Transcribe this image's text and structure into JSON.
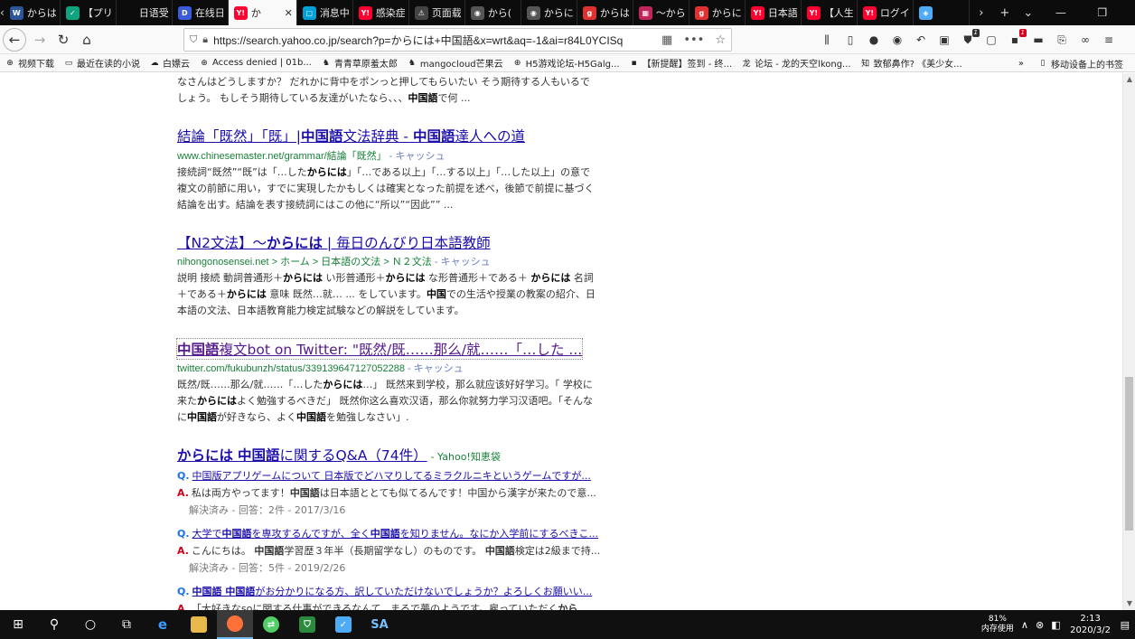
{
  "tabs": [
    {
      "label": "からは",
      "icon": "W",
      "color": "#2b579a"
    },
    {
      "label": "【プリ",
      "icon": "✓",
      "color": "#10a37f"
    },
    {
      "label": "日语受付",
      "icon": "",
      "color": "#0c0c0d"
    },
    {
      "label": "在线日",
      "icon": "D",
      "color": "#3b5bdb"
    },
    {
      "label": "か",
      "icon": "Y!",
      "color": "#ff0033",
      "active": true
    },
    {
      "label": "消息中",
      "icon": "▢",
      "color": "#00a1d6"
    },
    {
      "label": "感染症",
      "icon": "Y!",
      "color": "#ff0033"
    },
    {
      "label": "页面载",
      "icon": "⚠",
      "color": "#444444"
    },
    {
      "label": "から(",
      "icon": "◉",
      "color": "#555555"
    },
    {
      "label": "からに",
      "icon": "◉",
      "color": "#555555"
    },
    {
      "label": "からは",
      "icon": "g",
      "color": "#e03131"
    },
    {
      "label": "～から",
      "icon": "▦",
      "color": "#c2255c"
    },
    {
      "label": "からに",
      "icon": "g",
      "color": "#e03131"
    },
    {
      "label": "日本語",
      "icon": "Y!",
      "color": "#ff0033"
    },
    {
      "label": "【人生",
      "icon": "Y!",
      "color": "#ff0033"
    },
    {
      "label": "ログイ",
      "icon": "Y!",
      "color": "#ff0033"
    },
    {
      "label": "",
      "icon": "◈",
      "color": "#4dabf7"
    }
  ],
  "nav": {
    "url": "https://search.yahoo.co.jp/search?p=からには+中国語&x=wrt&aq=-1&ai=r84L0YCISq"
  },
  "bookmarks": [
    {
      "label": "视频下载",
      "icon": "⊕"
    },
    {
      "label": "最近在读的小说",
      "icon": "▭"
    },
    {
      "label": "白嫖云",
      "icon": "☁"
    },
    {
      "label": "Access denied | 01b...",
      "icon": "⊕"
    },
    {
      "label": "青青草原羞太郎",
      "icon": "♞"
    },
    {
      "label": "mangocloud芒果云",
      "icon": "♞"
    },
    {
      "label": "H5游戏论坛-H5Galg...",
      "icon": "⊕"
    },
    {
      "label": "【新提醒】签到 - 终...",
      "icon": "▪"
    },
    {
      "label": "论坛 - 龙的天空lkong...",
      "icon": "龙"
    },
    {
      "label": "致郁鼻作? 《美少女...",
      "icon": "知"
    }
  ],
  "bookmarks_mobile": "移动设备上的书签",
  "results": {
    "top_snippet": "なさんはどうしますか？ だれかに背中をポンっと押してもらいたい そう期待する人もいるでしょう。 もしそう期待している友達がいたなら、、、",
    "top_snippet_bold": "中国語",
    "top_snippet_tail": "で何 ...",
    "r1": {
      "title_a": "結論「既然」「既」|",
      "title_b": "中国語",
      "title_c": "文法辞典 -",
      "title_d": "中国語",
      "title_e": "達人への道",
      "url": "www.chinesemaster.net/grammar/結論「既然」",
      "cache": "- キャッシュ",
      "snippet": "接続詞“既然”“既”は「…した",
      "snippet_bold": "からには",
      "snippet_rest": "」「…である以上」「…する以上」「…した以上」の意で複文の前節に用い，すでに実現したかもしくは確実となった前提を述べ，後節で前提に基づく結論を出す。結論を表す接続詞にはこの他に“所以”“因此”” ..."
    },
    "r2": {
      "title_a": "【N2文法】～",
      "title_b": "からには",
      "title_c": "| 毎日のんびり日本語教師",
      "url": "nihongonosensei.net > ホーム > 日本語の文法 > Ｎ２文法",
      "cache": "- キャッシュ",
      "s1": "説明 接続 動詞普通形＋",
      "s1b": "からには",
      "s2": " い形普通形＋",
      "s2b": "からには",
      "s3": " な形普通形＋である＋ ",
      "s3b": "からには",
      "s4": " 名詞＋である＋",
      "s4b": "からには",
      "s5": " 意味 既然…就… ... をしています。",
      "s5b": "中国",
      "s6": "での生活や授業の教案の紹介、日本語の文法、日本語教育能力検定試験などの解説をしています。"
    },
    "r3": {
      "title_a": "中国語",
      "title_b": "複文bot on Twitter: \"既然/既……那么/就……「…した ...",
      "url": "twitter.com/fukubunzh/status/339139647127052288",
      "cache": "- キャッシュ",
      "s1": "既然/既……那么/就……「…した",
      "s1b": "からには",
      "s2": "…」 既然来到学校，那么就应该好好学习。「 学校に来た",
      "s2b": "からには",
      "s3": "よく勉強するべきだ」 既然你这么喜欢汉语，那么你就努力学习汉语吧。「そんなに",
      "s3b": "中国語",
      "s4": "が好きなら、よく",
      "s4b": "中国語",
      "s5": "を勉強しなさい」."
    },
    "qa": {
      "title_a": "からには",
      "title_b": "中国語",
      "title_c": "に関するQ&A（74件）",
      "source": "- Yahoo!知恵袋",
      "q_mark": "Q.",
      "a_mark": "A.",
      "items": [
        {
          "q": "中国版アプリゲームについて 日本版でどハマりしてるミラクルニキというゲームですが...",
          "a1": "私は両方やってます！",
          "ab": "中国語",
          "a2": "は日本語ととても似てるんです！中国から漢字が来たので意...",
          "meta": "解決済み - 回答：2件 - 2017/3/16"
        },
        {
          "q1": "大学で",
          "qb": "中国語",
          "q2": "を専攻するんですが、全く",
          "qb2": "中国語",
          "q3": "を知りません。なにか入学前にするべきこ...",
          "a1": "こんにちは。",
          "ab": "中国語",
          "a2": "学習歴３年半（長期留学なし）のものです。",
          "ab2": "中国語",
          "a3": "検定は2級まで持...",
          "meta": "解決済み - 回答：5件 - 2019/2/26"
        },
        {
          "qb": "中国語 中国語",
          "q2": "がお分かりになる方、訳していただけないでしょうか？よろしくお願いい...",
          "a1": "「大好きなsoに関する仕事ができるなんて、まるで夢のようです。雇っていただく",
          "ab": "から"
        }
      ]
    }
  },
  "taskbar": {
    "memory_pct": "81%",
    "memory_label": "内存使用",
    "time": "2:13",
    "date": "2020/3/2"
  }
}
